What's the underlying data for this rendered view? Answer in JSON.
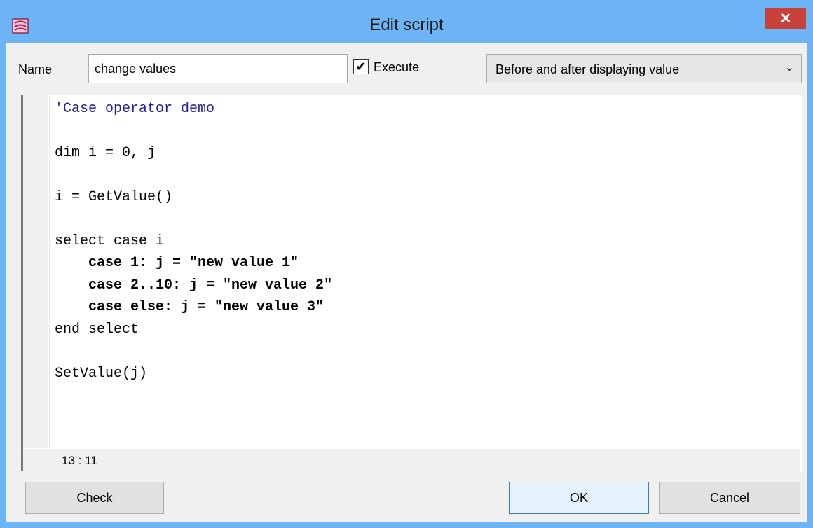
{
  "window": {
    "title": "Edit script",
    "close_glyph": "✕",
    "app_icon": "script-app-icon"
  },
  "form": {
    "name_label": "Name",
    "name_value": "change values",
    "execute_label": "Execute",
    "execute_checked": true,
    "execute_glyph": "✔",
    "mode_selected": "Before and after displaying value",
    "mode_chevron": "⌄"
  },
  "editor": {
    "lines": [
      "'Case operator demo",
      "",
      "dim i = 0, j",
      "",
      "i = GetValue()",
      "",
      "select case i",
      "    case 1: j = \"new value 1\"",
      "    case 2..10: j = \"new value 2\"",
      "    case else: j = \"new value 3\"",
      "end select",
      "",
      "SetValue(j)"
    ],
    "cursor_position": "13 : 11"
  },
  "buttons": {
    "check": "Check",
    "ok": "OK",
    "cancel": "Cancel"
  },
  "colors": {
    "title_bar": "#6cb4f5",
    "close_button": "#c8413a",
    "comment_text": "#1f1f9f"
  }
}
